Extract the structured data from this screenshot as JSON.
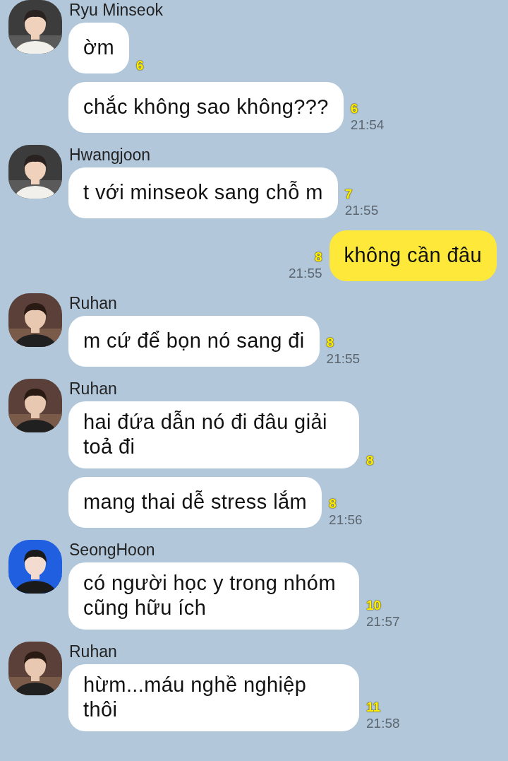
{
  "groups": [
    {
      "kind": "incoming",
      "sender": "Ryu Minseok",
      "messages": [
        {
          "text": "ờm",
          "unread": "6"
        },
        {
          "text": "chắc không sao không???",
          "unread": "6",
          "time": "21:54"
        }
      ]
    },
    {
      "kind": "incoming",
      "sender": "Hwangjoon",
      "messages": [
        {
          "text": "t với minseok sang chỗ m",
          "unread": "7",
          "time": "21:55"
        }
      ]
    },
    {
      "kind": "outgoing",
      "messages": [
        {
          "text": "không cần đâu",
          "unread": "8",
          "time": "21:55"
        }
      ]
    },
    {
      "kind": "incoming",
      "sender": "Ruhan",
      "messages": [
        {
          "text": "m cứ để bọn nó sang đi",
          "unread": "8",
          "time": "21:55"
        }
      ]
    },
    {
      "kind": "incoming",
      "sender": "Ruhan",
      "messages": [
        {
          "text": "hai đứa dẫn nó đi đâu giải toả đi",
          "unread": "8"
        },
        {
          "text": "mang thai dễ stress lắm",
          "unread": "8",
          "time": "21:56"
        }
      ]
    },
    {
      "kind": "incoming",
      "sender": "SeongHoon",
      "messages": [
        {
          "text": "có người học y trong nhóm cũng hữu ích",
          "unread": "10",
          "time": "21:57"
        }
      ]
    },
    {
      "kind": "incoming",
      "sender": "Ruhan",
      "messages": [
        {
          "text": "hừm...máu nghề nghiệp thôi",
          "unread": "11",
          "time": "21:58"
        }
      ]
    }
  ]
}
